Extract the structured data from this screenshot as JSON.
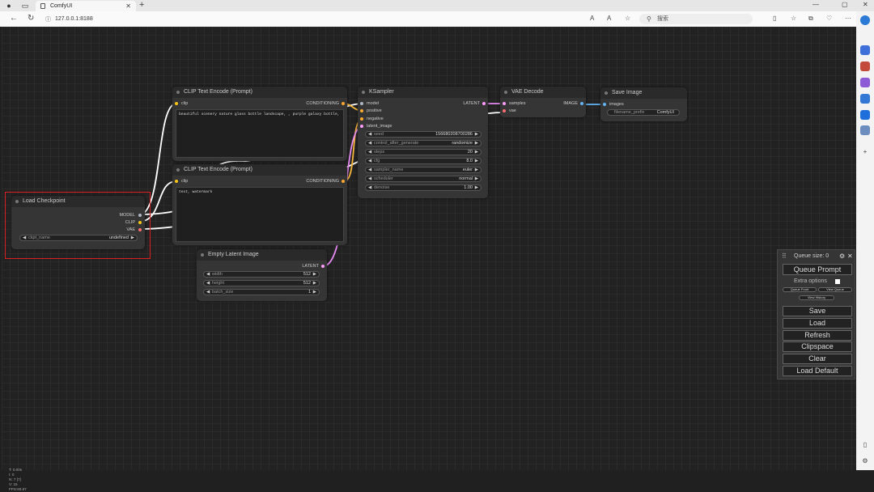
{
  "browser": {
    "tab_title": "ComfyUI",
    "url": "127.0.0.1:8188",
    "search_placeholder": "搜索"
  },
  "nodes": {
    "load_checkpoint": {
      "title": "Load Checkpoint",
      "outputs": [
        "MODEL",
        "CLIP",
        "VAE"
      ],
      "ckpt_label": "ckpt_name",
      "ckpt_value": "undefined"
    },
    "clip1": {
      "title": "CLIP Text Encode (Prompt)",
      "input": "clip",
      "output": "CONDITIONING",
      "text": "beautiful scenery nature glass bottle landscape, , purple galaxy bottle,"
    },
    "clip2": {
      "title": "CLIP Text Encode (Prompt)",
      "input": "clip",
      "output": "CONDITIONING",
      "text": "text, watermark"
    },
    "ksampler": {
      "title": "KSampler",
      "inputs": [
        "model",
        "positive",
        "negative",
        "latent_image"
      ],
      "output": "LATENT",
      "widgets": [
        {
          "name": "seed",
          "value": "156680208700286"
        },
        {
          "name": "control_after_generate",
          "value": "randomize"
        },
        {
          "name": "steps",
          "value": "20"
        },
        {
          "name": "cfg",
          "value": "8.0"
        },
        {
          "name": "sampler_name",
          "value": "euler"
        },
        {
          "name": "scheduler",
          "value": "normal"
        },
        {
          "name": "denoise",
          "value": "1.00"
        }
      ]
    },
    "vae_decode": {
      "title": "VAE Decode",
      "inputs": [
        "samples",
        "vae"
      ],
      "output": "IMAGE"
    },
    "save_image": {
      "title": "Save Image",
      "input": "images",
      "prefix_label": "filename_prefix",
      "prefix_value": "ComfyUI"
    },
    "empty_latent": {
      "title": "Empty Latent Image",
      "output": "LATENT",
      "widgets": [
        {
          "name": "width",
          "value": "512"
        },
        {
          "name": "height",
          "value": "512"
        },
        {
          "name": "batch_size",
          "value": "1"
        }
      ]
    }
  },
  "menu": {
    "queue_size": "Queue size: 0",
    "queue_prompt": "Queue Prompt",
    "extra_options": "Extra options",
    "queue_front": "Queue Front",
    "view_queue": "View Queue",
    "view_history": "View History",
    "save": "Save",
    "load": "Load",
    "refresh": "Refresh",
    "clipspace": "Clipspace",
    "clear": "Clear",
    "load_default": "Load Default"
  },
  "stats": [
    "T: 0.00s",
    "I: 0",
    "N: 7 [7]",
    "V: 15",
    "FPS:60.67"
  ],
  "colors": {
    "clip": "#f5c518",
    "model": "#b0b6c4",
    "vae": "#ff6e6e",
    "latent": "#ff9cf9",
    "image": "#64b5f6",
    "conditioning": "#ffa931",
    "selection": "#d91f1f"
  }
}
